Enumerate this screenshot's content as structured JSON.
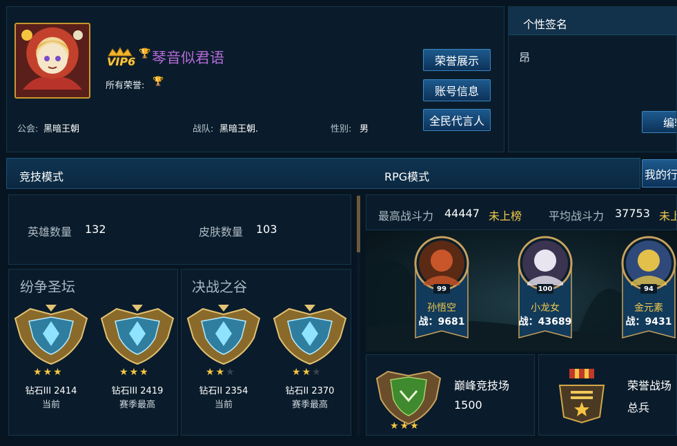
{
  "profile": {
    "vip_label": "VIP6",
    "name": "琴音似君语",
    "honors_label": "所有荣誉:",
    "guild_label": "公会:",
    "guild_value": "黑暗王朝",
    "team_label": "战队:",
    "team_value": "黑暗王朝.",
    "gender_label": "性别:",
    "gender_value": "男",
    "buttons": [
      "荣誉展示",
      "账号信息",
      "全民代言人"
    ]
  },
  "signature": {
    "title": "个性签名",
    "text": "昂",
    "edit_label": "编辑"
  },
  "mode_tabs": {
    "arena": "竞技模式",
    "rpg": "RPG模式",
    "my_btn": "我的行"
  },
  "counts": {
    "hero_label": "英雄数量",
    "hero_value": "132",
    "skin_label": "皮肤数量",
    "skin_value": "103"
  },
  "sections": [
    {
      "title": "纷争圣坛",
      "ranks": [
        {
          "caption": "钻石III 2414",
          "sub": "当前",
          "stars": 3
        },
        {
          "caption": "钻石III 2419",
          "sub": "赛季最高",
          "stars": 3
        }
      ]
    },
    {
      "title": "决战之谷",
      "ranks": [
        {
          "caption": "钻石II 2354",
          "sub": "当前",
          "stars": 2
        },
        {
          "caption": "钻石II 2370",
          "sub": "赛季最高",
          "stars": 2
        }
      ]
    }
  ],
  "power": {
    "max_label": "最高战斗力",
    "max_value": "44447",
    "max_rank": "未上榜",
    "avg_label": "平均战斗力",
    "avg_value": "37753",
    "avg_rank": "未上"
  },
  "heroes": [
    {
      "name": "孙悟空",
      "power": "战：9681",
      "level": "99"
    },
    {
      "name": "小龙女",
      "power": "战：43689",
      "level": "100"
    },
    {
      "name": "金元素",
      "power": "战：9431",
      "level": "94"
    }
  ],
  "peak": {
    "title": "巅峰竞技场",
    "value": "1500",
    "stars": 3
  },
  "honor_field": {
    "title": "荣誉战场",
    "value": "总兵"
  },
  "colors": {
    "accent_gold": "#f2c94c",
    "name_purple": "#b36ad6",
    "button_blue": "#1d5a8d"
  }
}
